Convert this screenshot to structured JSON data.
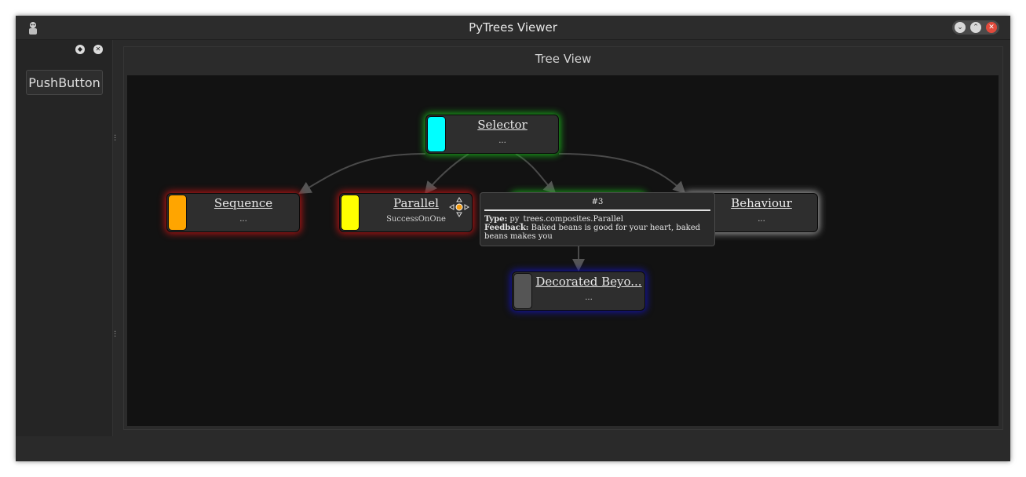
{
  "window": {
    "title": "PyTrees Viewer"
  },
  "dock": {
    "push_button_label": "PushButton"
  },
  "tree_view": {
    "title": "Tree View",
    "nodes": {
      "selector": {
        "name": "Selector",
        "detail": "...",
        "color": "#00ffff",
        "glow": "#1aa31a"
      },
      "sequence": {
        "name": "Sequence",
        "detail": "...",
        "color": "#ffa500",
        "glow": "#b01515"
      },
      "parallel": {
        "name": "Parallel",
        "detail": "SuccessOnOne",
        "color": "#ffff00",
        "glow": "#b01515"
      },
      "behaviour": {
        "name": "Behaviour",
        "detail": "...",
        "color": "#ffffff",
        "glow": "#9a9a9a"
      },
      "decorated": {
        "name": "Decorated Beyo...",
        "detail": "...",
        "color": "#555555",
        "glow": "#1515a0"
      }
    },
    "tooltip": {
      "id": "#3",
      "type_label": "Type:",
      "type_value": "py_trees.composites.Parallel",
      "feedback_label": "Feedback:",
      "feedback_value": "Baked beans is good for your heart, baked beans makes you"
    }
  }
}
